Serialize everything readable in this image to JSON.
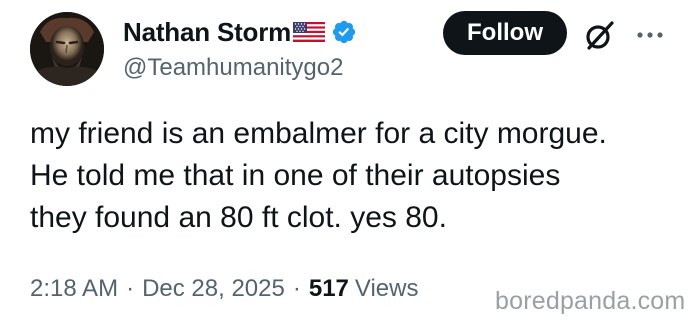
{
  "author": {
    "display_name": "Nathan Storm",
    "handle": "@Teamhumanitygo2",
    "flag_icon": "us-flag-icon",
    "badge_icon": "verified-badge-icon",
    "badge_color": "#1d9bf0"
  },
  "actions": {
    "follow_label": "Follow",
    "grok_icon": "grok-icon",
    "more_icon": "more-horizontal-icon"
  },
  "tweet": {
    "lines": [
      "my friend is an embalmer for a city morgue.",
      "He told me that in one of their autopsies",
      "they found an 80 ft clot. yes 80."
    ]
  },
  "meta": {
    "time": "2:18 AM",
    "date": "Dec 28, 2025",
    "separator": "·",
    "views_count": "517",
    "views_label": "Views"
  },
  "watermark": "boredpanda.com",
  "colors": {
    "text_primary": "#0f1419",
    "text_secondary": "#536471",
    "follow_bg": "#0f1419",
    "follow_text": "#ffffff",
    "watermark": "#9aa0a6"
  }
}
